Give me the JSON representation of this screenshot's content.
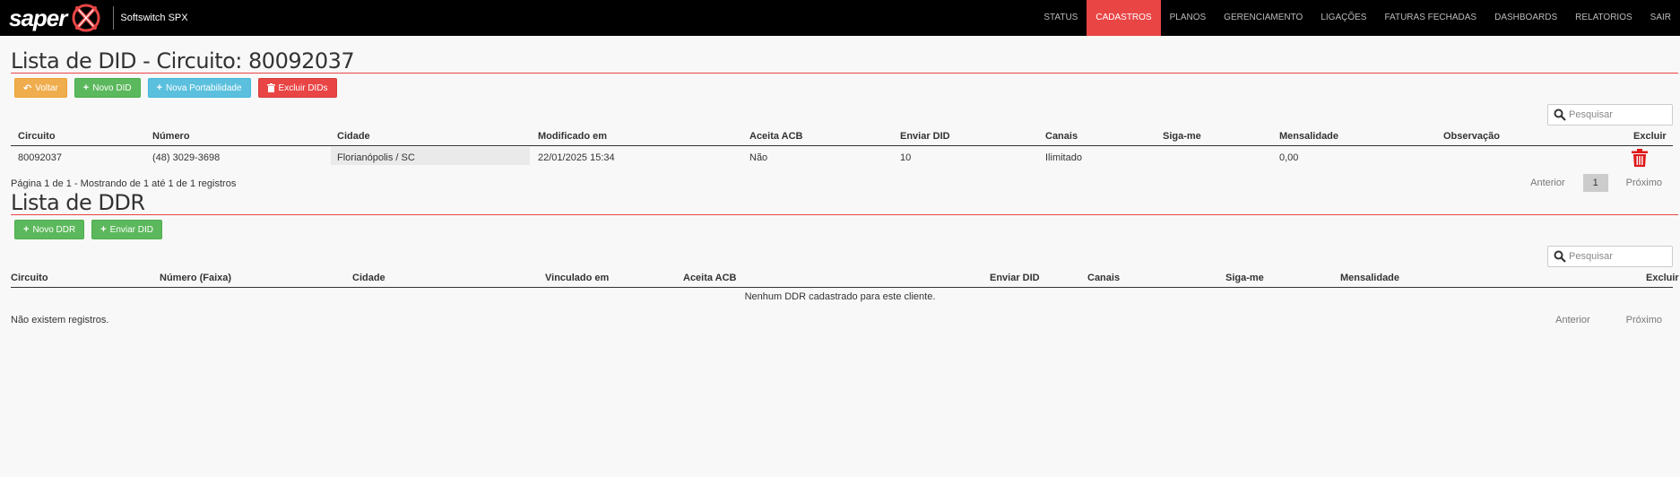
{
  "app": {
    "logo_text": "saper",
    "subtitle": "Softswitch SPX"
  },
  "nav": {
    "items": [
      {
        "label": "STATUS"
      },
      {
        "label": "CADASTROS",
        "active": true
      },
      {
        "label": "PLANOS"
      },
      {
        "label": "GERENCIAMENTO"
      },
      {
        "label": "LIGAÇÕES"
      },
      {
        "label": "FATURAS FECHADAS"
      },
      {
        "label": "DASHBOARDS"
      },
      {
        "label": "RELATORIOS"
      },
      {
        "label": "SAIR"
      }
    ]
  },
  "did_section": {
    "title": "Lista de DID - Circuito: 80092037",
    "buttons": {
      "back": "Voltar",
      "new_did": "Novo DID",
      "new_portability": "Nova Portabilidade",
      "delete_dids": "Excluir DIDs"
    },
    "search_placeholder": "Pesquisar",
    "columns": [
      "Circuito",
      "Número",
      "Cidade",
      "Modificado em",
      "Aceita ACB",
      "Enviar DID",
      "Canais",
      "Siga-me",
      "Mensalidade",
      "Observação",
      "Excluir"
    ],
    "rows": [
      {
        "circuito": "80092037",
        "numero": "(48) 3029-3698",
        "cidade": "Florianópolis / SC",
        "modificado": "22/01/2025 15:34",
        "aceita_acb": "Não",
        "enviar_did": "10",
        "canais": "Ilimitado",
        "siga_me": "",
        "mensalidade": "0,00",
        "observacao": ""
      }
    ],
    "info": "Página 1 de 1 - Mostrando de 1 até 1 de 1 registros",
    "pager": {
      "prev": "Anterior",
      "current": "1",
      "next": "Próximo"
    }
  },
  "ddr_section": {
    "title": "Lista de DDR",
    "buttons": {
      "new_ddr": "Novo DDR",
      "send_did": "Enviar DID"
    },
    "search_placeholder": "Pesquisar",
    "columns": [
      "Circuito",
      "Número (Faixa)",
      "Cidade",
      "Vinculado em",
      "Aceita ACB",
      "Enviar DID",
      "Canais",
      "Siga-me",
      "Mensalidade",
      "Excluir"
    ],
    "empty_message": "Nenhum DDR cadastrado para este cliente.",
    "info": "Não existem registros.",
    "pager": {
      "prev": "Anterior",
      "next": "Próximo"
    }
  },
  "colors": {
    "navbar": "#000000",
    "accent_red": "#e94545",
    "btn_orange": "#f0ad4e",
    "btn_green": "#5cb85c",
    "btn_blue": "#5bc0de"
  }
}
